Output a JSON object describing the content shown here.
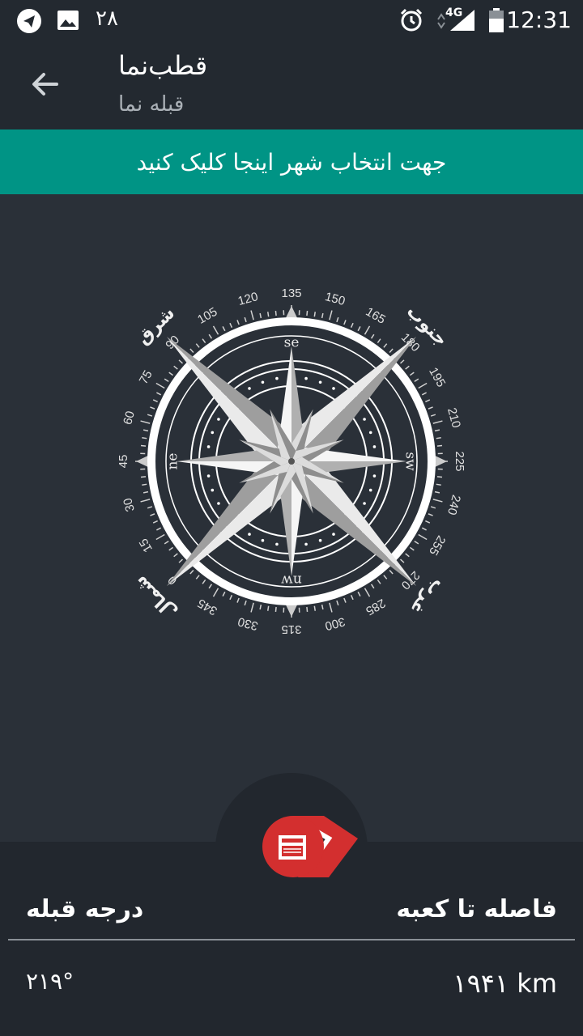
{
  "status_bar": {
    "notification_count": "۲۸",
    "network": "4G",
    "time": "12:31"
  },
  "app_bar": {
    "title": "قطب‌نما",
    "subtitle": "قبله نما"
  },
  "banner": {
    "text": "جهت انتخاب شهر اینجا کلیک کنید"
  },
  "compass": {
    "corner_labels": [
      "شرق",
      "جنوب",
      "غرب",
      "شمال"
    ],
    "cardinal_labels": [
      "se",
      "sw",
      "nw",
      "ne"
    ],
    "degree_labels": [
      "135",
      "150",
      "165",
      "180",
      "195",
      "210",
      "225",
      "240",
      "255",
      "270",
      "285",
      "300",
      "315",
      "330",
      "345",
      "0",
      "15",
      "30",
      "45",
      "60",
      "75",
      "90",
      "105",
      "120"
    ],
    "heading_deg": 135
  },
  "info": {
    "distance_label": "فاصله تا کعبه",
    "distance_value": "۱۹۴۱ km",
    "qibla_label": "درجه قبله",
    "qibla_value": "۲۱۹°"
  },
  "colors": {
    "accent": "#009485",
    "background": "#2a3038",
    "bar": "#232930",
    "kaaba_red": "#d32f2f"
  }
}
